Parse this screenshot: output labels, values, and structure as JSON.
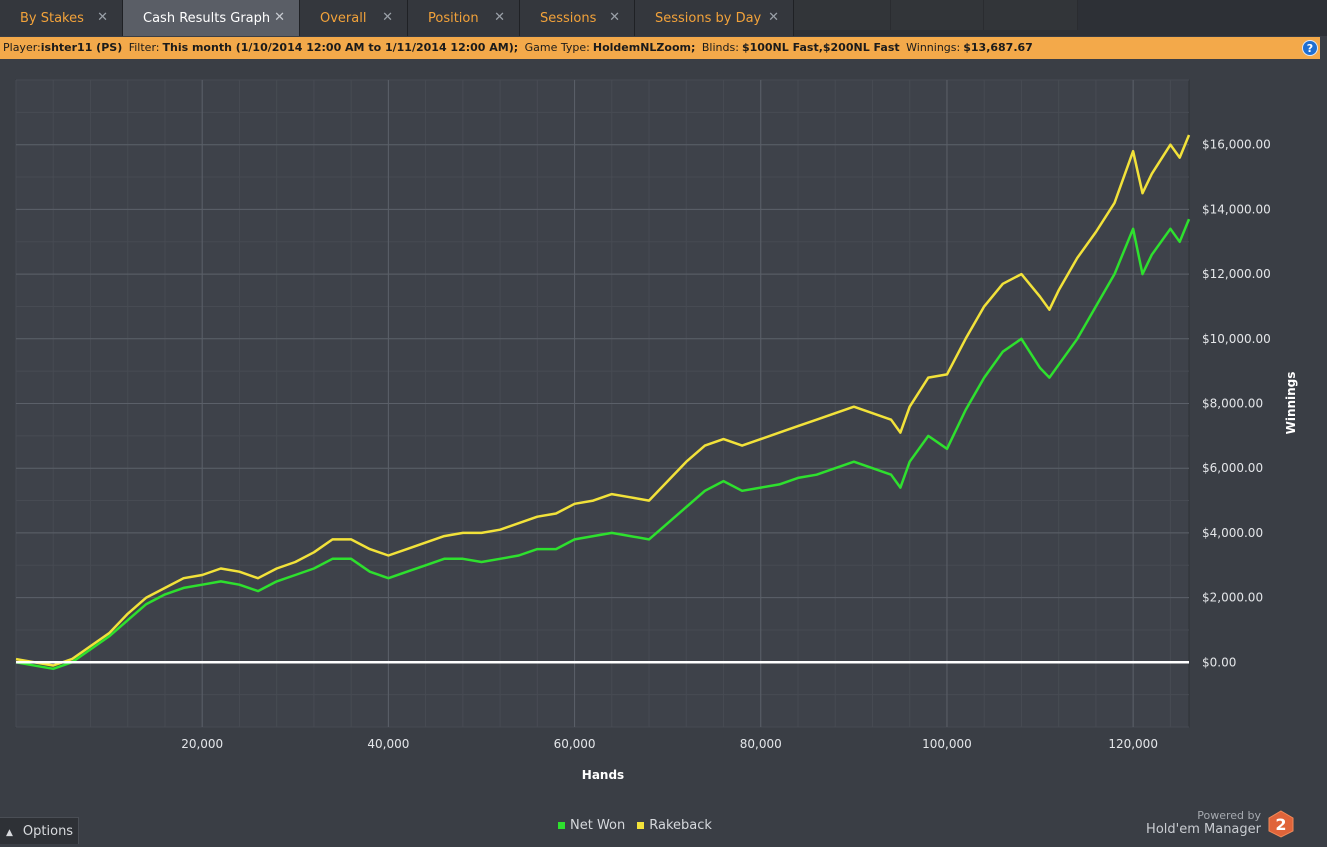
{
  "tabs": [
    {
      "label": "By Stakes",
      "close": "✕",
      "active": false
    },
    {
      "label": "Cash Results Graph",
      "close": "✕",
      "active": true
    },
    {
      "label": "Overall",
      "close": "✕",
      "active": false
    },
    {
      "label": "Position",
      "close": "✕",
      "active": false
    },
    {
      "label": "Sessions",
      "close": "✕",
      "active": false
    },
    {
      "label": "Sessions by Day",
      "close": "✕",
      "active": false
    }
  ],
  "filter": {
    "player_label": "Player:",
    "player_value": "ishter11 (PS)",
    "filter_label": "Filter:",
    "filter_value": "This month (1/10/2014 12:00 AM to 1/11/2014 12:00 AM);",
    "game_label": "Game Type:",
    "game_value": "HoldemNLZoom;",
    "blinds_label": "Blinds:",
    "blinds_value": "$100NL Fast,$200NL Fast",
    "winnings_label": "Winnings:",
    "winnings_value": "$13,687.67",
    "help": "?"
  },
  "options": {
    "label": "Options",
    "icon": "caret-up-icon"
  },
  "brand": {
    "powered_by": "Powered by",
    "name": "Hold'em Manager",
    "logo_number": "2"
  },
  "colors": {
    "net_won": "#2ee02e",
    "rakeback": "#f2e23a",
    "zero_line": "#ffffff",
    "accent": "#f3a94a"
  },
  "chart_data": {
    "type": "line",
    "xlabel": "Hands",
    "ylabel": "Winnings",
    "xlim": [
      0,
      126000
    ],
    "ylim": [
      -2000,
      18000
    ],
    "x_ticks": [
      20000,
      40000,
      60000,
      80000,
      100000,
      120000
    ],
    "x_tick_labels": [
      "20,000",
      "40,000",
      "60,000",
      "80,000",
      "100,000",
      "120,000"
    ],
    "y_ticks": [
      0,
      2000,
      4000,
      6000,
      8000,
      10000,
      12000,
      14000,
      16000
    ],
    "y_tick_labels": [
      "$0.00",
      "$2,000.00",
      "$4,000.00",
      "$6,000.00",
      "$8,000.00",
      "$10,000.00",
      "$12,000.00",
      "$14,000.00",
      "$16,000.00"
    ],
    "grid": true,
    "legend_position": "bottom-center",
    "x": [
      0,
      4000,
      6000,
      8000,
      10000,
      12000,
      14000,
      16000,
      18000,
      20000,
      22000,
      24000,
      26000,
      28000,
      30000,
      32000,
      34000,
      36000,
      38000,
      40000,
      42000,
      44000,
      46000,
      48000,
      50000,
      52000,
      54000,
      56000,
      58000,
      60000,
      62000,
      64000,
      66000,
      68000,
      70000,
      72000,
      74000,
      76000,
      78000,
      80000,
      82000,
      84000,
      86000,
      88000,
      90000,
      92000,
      94000,
      95000,
      96000,
      98000,
      100000,
      102000,
      104000,
      106000,
      108000,
      110000,
      111000,
      112000,
      114000,
      116000,
      118000,
      120000,
      121000,
      122000,
      124000,
      125000,
      126000
    ],
    "series": [
      {
        "name": "Net Won",
        "values": [
          0,
          -200,
          0,
          400,
          800,
          1300,
          1800,
          2100,
          2300,
          2400,
          2500,
          2400,
          2200,
          2500,
          2700,
          2900,
          3200,
          3200,
          2800,
          2600,
          2800,
          3000,
          3200,
          3200,
          3100,
          3200,
          3300,
          3500,
          3500,
          3800,
          3900,
          4000,
          3900,
          3800,
          4300,
          4800,
          5300,
          5600,
          5300,
          5400,
          5500,
          5700,
          5800,
          6000,
          6200,
          6000,
          5800,
          5400,
          6200,
          7000,
          6600,
          7800,
          8800,
          9600,
          10000,
          9100,
          8800,
          9200,
          10000,
          11000,
          12000,
          13400,
          12000,
          12600,
          13400,
          13000,
          13700
        ]
      },
      {
        "name": "Rakeback",
        "values": [
          100,
          -100,
          100,
          500,
          900,
          1500,
          2000,
          2300,
          2600,
          2700,
          2900,
          2800,
          2600,
          2900,
          3100,
          3400,
          3800,
          3800,
          3500,
          3300,
          3500,
          3700,
          3900,
          4000,
          4000,
          4100,
          4300,
          4500,
          4600,
          4900,
          5000,
          5200,
          5100,
          5000,
          5600,
          6200,
          6700,
          6900,
          6700,
          6900,
          7100,
          7300,
          7500,
          7700,
          7900,
          7700,
          7500,
          7100,
          7900,
          8800,
          8900,
          10000,
          11000,
          11700,
          12000,
          11300,
          10900,
          11500,
          12500,
          13300,
          14200,
          15800,
          14500,
          15100,
          16000,
          15600,
          16300
        ]
      }
    ]
  }
}
